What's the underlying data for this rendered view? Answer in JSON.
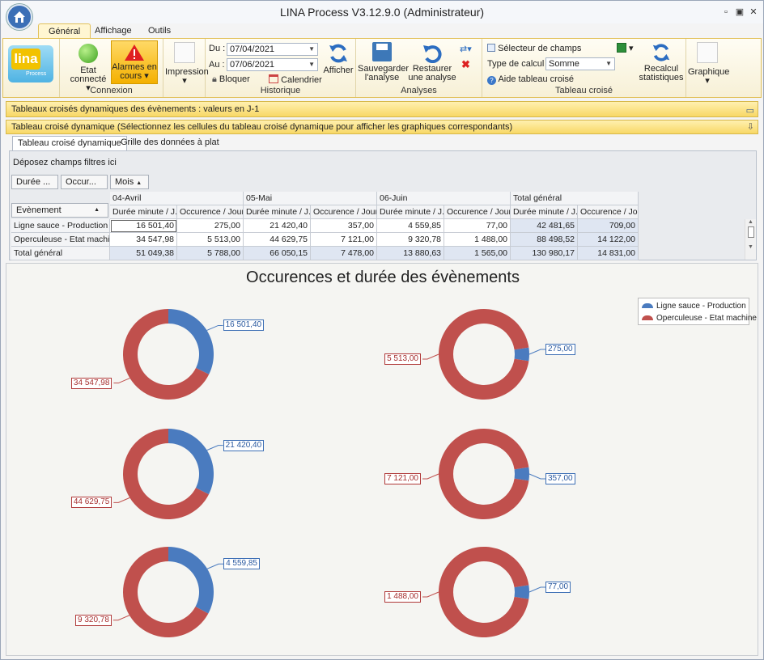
{
  "window": {
    "title": "LINA Process  V3.12.9.0  (Administrateur)"
  },
  "tabs": [
    "Général",
    "Affichage",
    "Outils"
  ],
  "ribbon": {
    "logo_text": "lina",
    "logo_sub": "Process",
    "etat_line1": "Etat",
    "etat_line2": "connecté",
    "alarmes_line1": "Alarmes en",
    "alarmes_line2": "cours",
    "connexion_label": "Connexion",
    "impression": "Impression",
    "du_label": "Du :",
    "du_value": "07/04/2021",
    "au_label": "Au :",
    "au_value": "07/06/2021",
    "bloquer": "Bloquer",
    "calendrier": "Calendrier",
    "afficher": "Afficher",
    "historique_label": "Historique",
    "sauvegarder_line1": "Sauvegarder",
    "sauvegarder_line2": "l'analyse",
    "restaurer_line1": "Restaurer",
    "restaurer_line2": "une analyse",
    "analyses_label": "Analyses",
    "selecteur": "Sélecteur de champs",
    "type_calcul_label": "Type de calcul :",
    "type_calcul_value": "Somme",
    "aide": "Aide tableau croisé",
    "recalcul_line1": "Recalcul",
    "recalcul_line2": "statistiques",
    "tableau_croise_label": "Tableau croisé",
    "graphique": "Graphique"
  },
  "bars": {
    "main": "Tableaux croisés dynamiques des évènements : valeurs en J-1",
    "sub": "Tableau croisé dynamique (Sélectionnez les cellules du tableau croisé dynamique pour afficher les graphiques correspondants)"
  },
  "subtabs": [
    "Tableau croisé dynamique",
    "Grille des données à plat"
  ],
  "pivot": {
    "filter_drop": "Déposez champs filtres ici",
    "field_btns": [
      "Durée ...",
      "Occur...",
      "Mois"
    ],
    "row_field": "Evènement",
    "col_groups": [
      "04-Avril",
      "05-Mai",
      "06-Juin",
      "Total général"
    ],
    "col_sub": [
      "Durée minute / J...",
      "Occurence / Jour"
    ],
    "rows": [
      {
        "label": "Ligne sauce - Production",
        "values": [
          "16 501,40",
          "275,00",
          "21 420,40",
          "357,00",
          "4 559,85",
          "77,00",
          "42 481,65",
          "709,00"
        ]
      },
      {
        "label": "Operculeuse - Etat machine",
        "values": [
          "34 547,98",
          "5 513,00",
          "44 629,75",
          "7 121,00",
          "9 320,78",
          "1 488,00",
          "88 498,52",
          "14 122,00"
        ]
      },
      {
        "label": "Total général",
        "values": [
          "51 049,38",
          "5 788,00",
          "66 050,15",
          "7 478,00",
          "13 880,63",
          "1 565,00",
          "130 980,17",
          "14 831,00"
        ]
      }
    ]
  },
  "chart": {
    "title": "Occurences et durée des évènements",
    "legend": [
      "Ligne sauce - Production",
      "Operculeuse - Etat machine"
    ],
    "colors": {
      "blue": "#4a7bbf",
      "red": "#c0504d"
    }
  },
  "chart_data": {
    "type": "pie",
    "title": "Occurences et durée des évènements",
    "series_names": [
      "Ligne sauce - Production",
      "Operculeuse - Etat machine"
    ],
    "donuts": [
      {
        "values": [
          16501.4,
          34547.98
        ],
        "labels": [
          "16 501,40",
          "34 547,98"
        ]
      },
      {
        "values": [
          275.0,
          5513.0
        ],
        "labels": [
          "275,00",
          "5 513,00"
        ]
      },
      {
        "values": [
          21420.4,
          44629.75
        ],
        "labels": [
          "21 420,40",
          "44 629,75"
        ]
      },
      {
        "values": [
          357.0,
          7121.0
        ],
        "labels": [
          "357,00",
          "7 121,00"
        ]
      },
      {
        "values": [
          4559.85,
          9320.78
        ],
        "labels": [
          "4 559,85",
          "9 320,78"
        ]
      },
      {
        "values": [
          77.0,
          1488.0
        ],
        "labels": [
          "77,00",
          "1 488,00"
        ]
      }
    ]
  }
}
